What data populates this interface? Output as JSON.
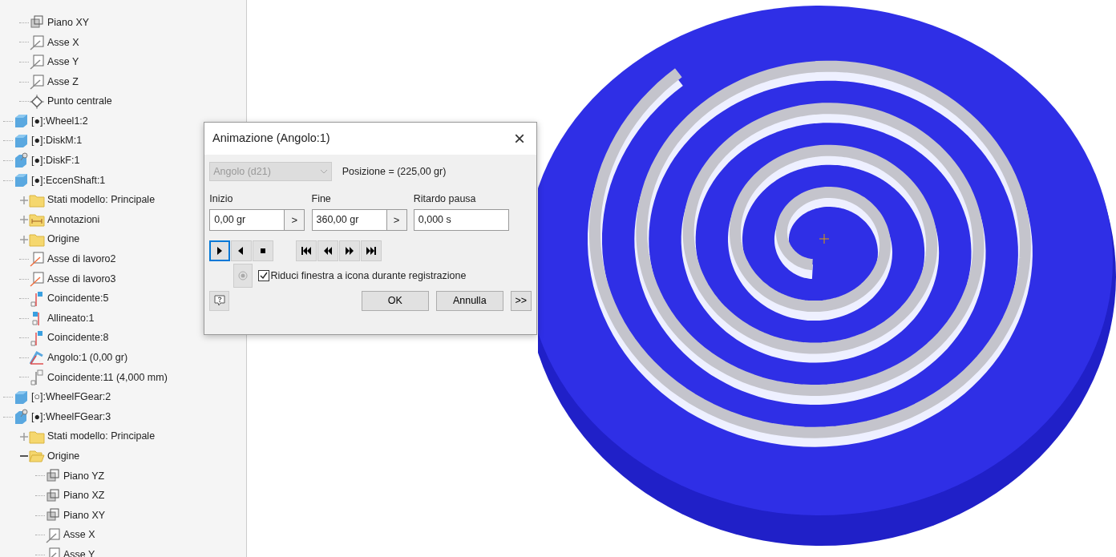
{
  "tree_continued": [
    {
      "label": "Piano XY",
      "kind": "plane"
    },
    {
      "label": "Asse X",
      "kind": "axis"
    },
    {
      "label": "Asse Y",
      "kind": "axis"
    },
    {
      "label": "Asse Z",
      "kind": "axis"
    },
    {
      "label": "Punto centrale",
      "kind": "point"
    }
  ],
  "tree": [
    {
      "label": "[●]:Wheel1:2",
      "kind": "part"
    },
    {
      "label": "[●]:DiskM:1",
      "kind": "part"
    },
    {
      "label": "[●]:DiskF:1",
      "kind": "part-pinned"
    },
    {
      "label": "[●]:EccenShaft:1",
      "kind": "part",
      "children": [
        {
          "label": "Stati modello: Principale",
          "kind": "folder",
          "expanded": false
        },
        {
          "label": "Annotazioni",
          "kind": "annotations",
          "expanded": false
        },
        {
          "label": "Origine",
          "kind": "folder",
          "expanded": false
        },
        {
          "label": "Asse di lavoro2",
          "kind": "work-axis"
        },
        {
          "label": "Asse di lavoro3",
          "kind": "work-axis"
        },
        {
          "label": "Coincidente:5",
          "kind": "mate"
        },
        {
          "label": "Allineato:1",
          "kind": "flush"
        },
        {
          "label": "Coincidente:8",
          "kind": "mate"
        },
        {
          "label": "Angolo:1 (0,00 gr)",
          "kind": "angle"
        },
        {
          "label": "Coincidente:11 (4,000 mm)",
          "kind": "mate-grey"
        }
      ]
    },
    {
      "label": "[○]:WheelFGear:2",
      "kind": "part"
    },
    {
      "label": "[●]:WheelFGear:3",
      "kind": "part-pinned",
      "children": [
        {
          "label": "Stati modello: Principale",
          "kind": "folder",
          "expanded": false
        },
        {
          "label": "Origine",
          "kind": "folder",
          "expanded": true,
          "children": [
            {
              "label": "Piano YZ",
              "kind": "plane"
            },
            {
              "label": "Piano XZ",
              "kind": "plane"
            },
            {
              "label": "Piano XY",
              "kind": "plane"
            },
            {
              "label": "Asse X",
              "kind": "axis"
            },
            {
              "label": "Asse Y",
              "kind": "axis"
            }
          ]
        }
      ]
    }
  ],
  "dialog": {
    "title": "Animazione (Angolo:1)",
    "close": "×",
    "parameter": {
      "value": "Angolo (d21)",
      "disabled": true
    },
    "position": "Posizione = (225,00 gr)",
    "fields": [
      {
        "label": "Inizio",
        "value": "0,00 gr",
        "arrow": ">"
      },
      {
        "label": "Fine",
        "value": "360,00 gr",
        "arrow": ">"
      },
      {
        "label": "Ritardo pausa",
        "value": "0,000 s"
      }
    ],
    "playback": [
      {
        "kind": "play",
        "selected": true
      },
      {
        "kind": "reverse",
        "selected": false
      },
      {
        "kind": "stop",
        "selected": false
      }
    ],
    "steps": [
      {
        "kind": "first"
      },
      {
        "kind": "rewind"
      },
      {
        "kind": "forward"
      },
      {
        "kind": "last"
      }
    ],
    "record": {
      "disabled": true
    },
    "minimize": {
      "label": "Riduci finestra a icona durante registrazione",
      "checked": true
    },
    "buttons": [
      "OK",
      "Annulla"
    ],
    "more": ">>"
  }
}
